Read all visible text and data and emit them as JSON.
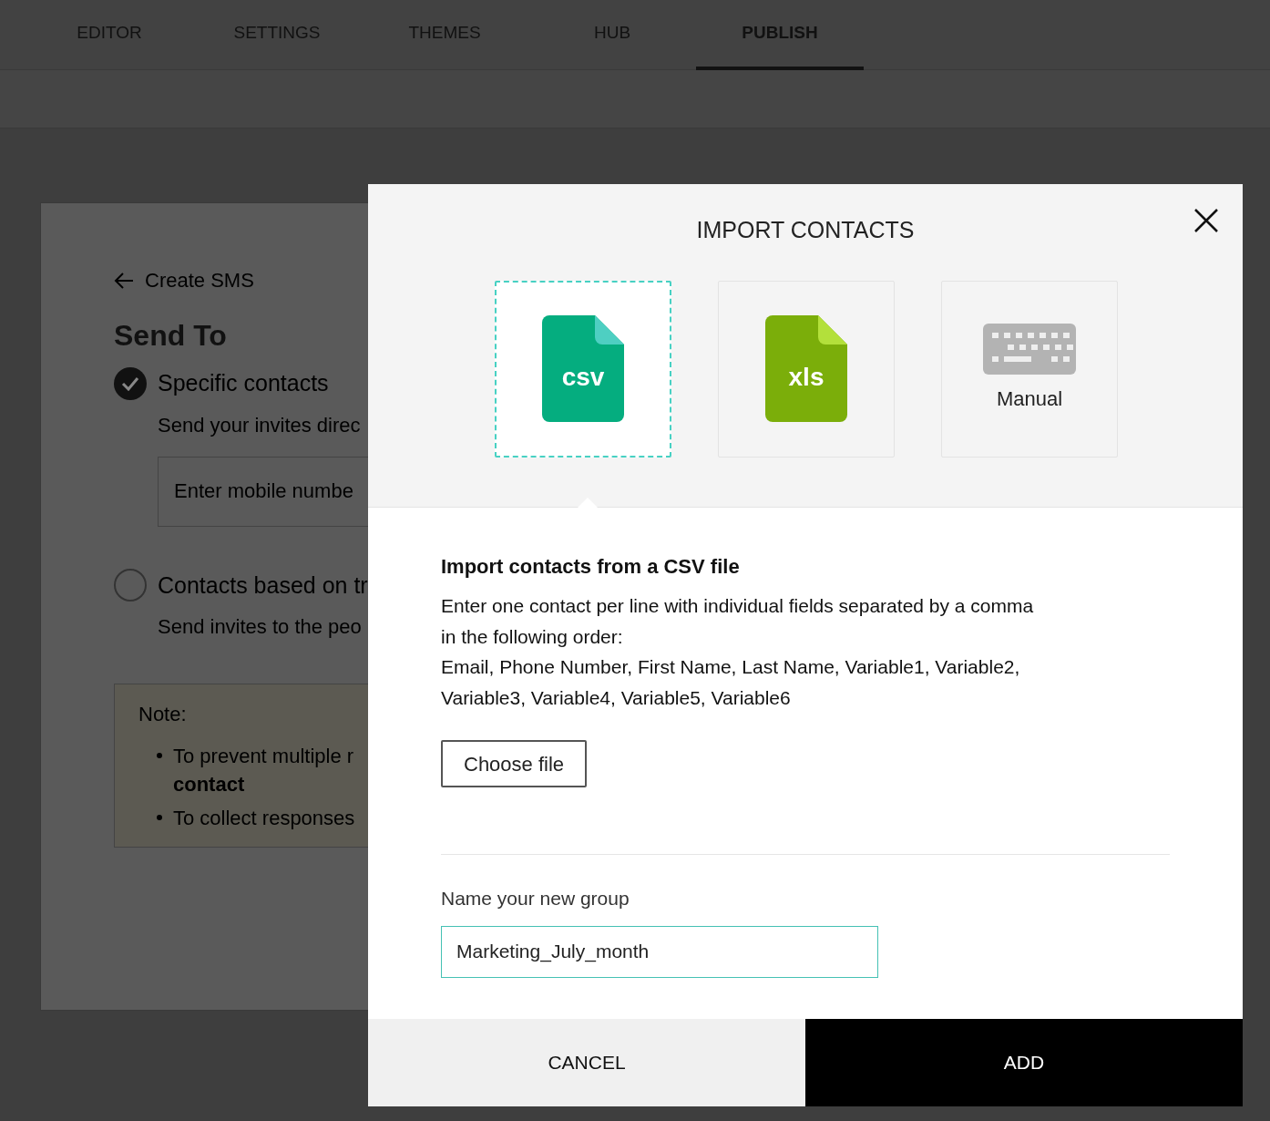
{
  "tabs": [
    {
      "label": "EDITOR",
      "selected": false
    },
    {
      "label": "SETTINGS",
      "selected": false
    },
    {
      "label": "THEMES",
      "selected": false
    },
    {
      "label": "HUB",
      "selected": false
    },
    {
      "label": "PUBLISH",
      "selected": true
    }
  ],
  "background": {
    "back_link": "Create SMS",
    "heading": "Send To",
    "options": [
      {
        "label": "Specific contacts",
        "description": "Send your invites direc",
        "selected": true,
        "placeholder": "Enter mobile numbe"
      },
      {
        "label": "Contacts based on tr",
        "description": "Send invites to the peo",
        "selected": false
      }
    ],
    "note": {
      "title": "Note:",
      "items": [
        "To prevent multiple r **contact**",
        "To collect responses"
      ]
    }
  },
  "dialog": {
    "title": "IMPORT CONTACTS",
    "sources": [
      {
        "kind": "csv",
        "label": "csv",
        "selected": true
      },
      {
        "kind": "xls",
        "label": "xls",
        "selected": false
      },
      {
        "kind": "manual",
        "label": "Manual",
        "selected": false
      }
    ],
    "section_title": "Import contacts from a CSV file",
    "instructions": [
      "Enter one contact per line with individual fields separated by a comma in the following order:",
      "Email, Phone Number, First Name, Last Name, Variable1, Variable2, Variable3, Variable4, Variable5, Variable6"
    ],
    "choose_button": "Choose file",
    "group_label": "Name your new group",
    "group_value": "Marketing_July_month",
    "buttons": [
      {
        "kind": "secondary",
        "label": "CANCEL"
      },
      {
        "kind": "primary",
        "label": "ADD"
      }
    ]
  }
}
